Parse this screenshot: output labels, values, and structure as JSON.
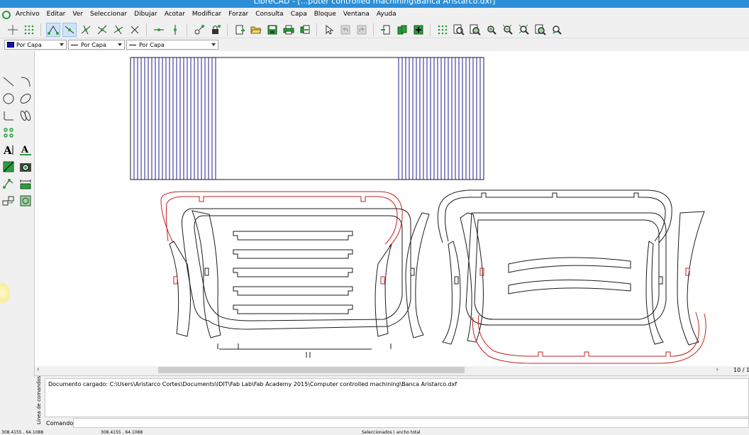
{
  "window": {
    "title": "LibreCAD - [...puter controlled machining\\Banca Aristarco.dxf]"
  },
  "menu": [
    "Archivo",
    "Editar",
    "Ver",
    "Seleccionar",
    "Dibujar",
    "Acotar",
    "Modificar",
    "Forzar",
    "Consulta",
    "Capa",
    "Bloque",
    "Ventana",
    "Ayuda"
  ],
  "properties": {
    "color": "Por Capa",
    "width": "Por Capa",
    "linetype": "Por Capa",
    "color_swatch": "#1010c0"
  },
  "toolbar_icons": {
    "snap": [
      "snap-free-icon",
      "snap-grid-icon",
      "snap-endpoint-icon",
      "snap-on-entity-icon",
      "snap-center-icon",
      "snap-middle-icon",
      "snap-distance-icon",
      "snap-intersection-icon",
      "restrict-horizontal-icon",
      "restrict-vertical-icon",
      "relative-zero-icon",
      "lock-relative-zero-icon"
    ],
    "file": [
      "new-file-icon",
      "open-file-icon",
      "save-file-icon",
      "print-icon",
      "print-preview-icon"
    ],
    "edit": [
      "select-pointer-icon",
      "undo-icon",
      "redo-icon",
      "cut-icon",
      "copy-icon",
      "paste-icon"
    ],
    "view": [
      "grid-toggle-icon",
      "zoom-redraw-icon",
      "zoom-window-icon",
      "zoom-in-icon",
      "zoom-out-icon",
      "zoom-auto-icon",
      "zoom-previous-icon",
      "zoom-pan-icon"
    ]
  },
  "side_tools": [
    "line-icon",
    "arc-icon",
    "circle-icon",
    "ellipse-icon",
    "polyline-icon",
    "spline-icon",
    "select-icon",
    "text-icon",
    "text-style-icon",
    "hatch-icon",
    "image-icon",
    "modify-icon",
    "dimension-icon",
    "block-icon",
    "info-icon"
  ],
  "scroll": {
    "right_readout": "10 / 1"
  },
  "command": {
    "dock_title": "Línea de comandos",
    "history": [
      "Documento cargado: C:\\Users\\Aristarco Cortes\\Documents\\IDIT\\Fab Lab\\Fab Academy 2015\\Computer controlled machining\\Banca Aristarco.dxf"
    ],
    "prompt_label": "Comando:",
    "input_value": ""
  },
  "status": {
    "abs_coords": "308.4155 , 64.1088",
    "rel_coords": "308.4155 , 64.1088",
    "selection": "Seleccionados | ancho total"
  },
  "colors": {
    "drawing_blue": "#1c1c8c",
    "drawing_red": "#c42020",
    "drawing_black": "#1a1a1a",
    "title_blue": "#2b8fd8"
  }
}
